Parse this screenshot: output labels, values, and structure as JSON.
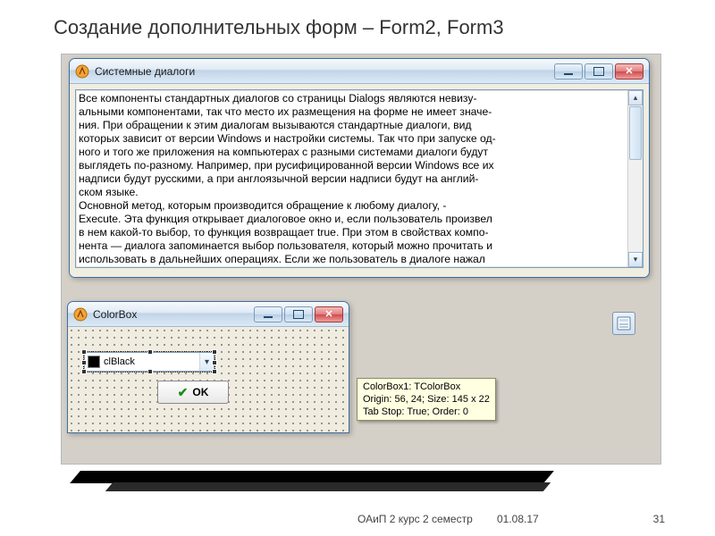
{
  "slide": {
    "title": "Создание дополнительных форм – Form2, Form3",
    "course_footer": "ОАиП 2 курс 2 семестр",
    "date_footer": "01.08.17",
    "page_number": "31"
  },
  "window1": {
    "title": "Системные диалоги",
    "memo_text": "Все компоненты стандартных диалогов со страницы Dialogs являются невизу-\nальными компонентами, так что место их размещения на форме не имеет значе-\nния. При обращении к этим диалогам вызываются стандартные диалоги, вид\nкоторых зависит от версии Windows и настройки системы. Так что при запуске од-\nного и того же приложения на компьютерах с разными системами диалоги будут\nвыглядеть по-разному. Например, при русифицированной версии Windows все их\nнадписи будут русскими, а при англоязычной версии надписи будут на англий-\nском языке.\nОсновной метод, которым производится обращение к любому диалогу, -\nExecute. Эта функция открывает диалоговое окно и, если пользователь произвел\nв нем какой-то выбор, то функция возвращает true. При этом в свойствах компо-\nнента — диалога запоминается выбор пользователя, который можно прочитать и\nиспользовать в дальнейших операциях. Если же пользователь в диалоге нажал"
  },
  "window2": {
    "title": "ColorBox",
    "colorbox_value": "clBlack",
    "ok_label": "OK"
  },
  "hint": {
    "line1": "ColorBox1: TColorBox",
    "line2": "Origin: 56, 24; Size: 145 x 22",
    "line3": "Tab Stop: True; Order: 0"
  }
}
